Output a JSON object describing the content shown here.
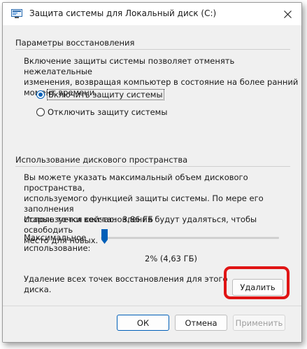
{
  "window": {
    "title": "Защита системы для Локальный диск (C:)"
  },
  "restore": {
    "group_title": "Параметры восстановления",
    "description_lines": [
      "Включение защиты системы позволяет отменять нежелательные",
      "изменения, возвращая компьютер в состояние на более ранний",
      "момент времени."
    ],
    "options": [
      {
        "label": "Включить защиту системы",
        "checked": true
      },
      {
        "label": "Отключить защиту системы",
        "checked": false
      }
    ]
  },
  "disk_usage": {
    "group_title": "Использование дискового пространства",
    "description_lines": [
      "Вы можете указать максимальный объем дискового пространства,",
      "используемого функцией защиты системы. По мере его заполнения",
      "старые точки восстановления будут удаляться, чтобы освободить",
      "место для новых."
    ],
    "current_usage_label": "Используется сейчас:",
    "current_usage_value": "3,86 ГБ",
    "max_usage_label_line1": "Максимальное",
    "max_usage_label_line2": "использование:",
    "slider_percent": 2,
    "slider_value_text": "2% (4,63 ГБ)",
    "delete_text_line1": "Удаление всех точек восстановления для этого",
    "delete_text_line2": "диска.",
    "delete_button": "Удалить"
  },
  "footer": {
    "ok": "ОК",
    "cancel": "Отмена",
    "apply": "Применить"
  },
  "colors": {
    "accent": "#005fb8",
    "highlight": "#e01414"
  }
}
